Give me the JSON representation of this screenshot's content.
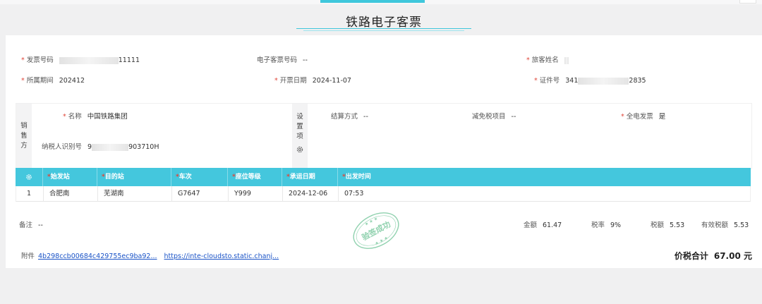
{
  "title": "铁路电子客票",
  "fields": {
    "invoice_no": {
      "label": "发票号码",
      "value": "11111"
    },
    "e_ticket_no": {
      "label": "电子客票号码",
      "value": "--"
    },
    "passenger": {
      "label": "旅客姓名",
      "value": ""
    },
    "period": {
      "label": "所属期间",
      "value": "202412"
    },
    "issue_date": {
      "label": "开票日期",
      "value": "2024-11-07"
    },
    "id_no": {
      "label": "证件号",
      "value_prefix": "341",
      "value_suffix": "2835"
    }
  },
  "seller": {
    "side_label": [
      "销",
      "售",
      "方"
    ],
    "name": {
      "label": "名称",
      "value": "中国铁路集团"
    },
    "tax_id": {
      "label": "纳税人识别号",
      "value_prefix": "9",
      "value_suffix": "903710H"
    }
  },
  "settings": {
    "side_label": [
      "设",
      "置",
      "项"
    ],
    "settlement": {
      "label": "结算方式",
      "value": "--"
    },
    "tax_exempt": {
      "label": "减免税项目",
      "value": "--"
    },
    "full_e_invoice": {
      "label": "全电发票",
      "value": "是"
    }
  },
  "table": {
    "columns": [
      "始发站",
      "目的站",
      "车次",
      "座位等级",
      "承运日期",
      "出发时间"
    ],
    "rows": [
      {
        "index": "1",
        "cells": [
          "合肥南",
          "芜湖南",
          "G7647",
          "Y999",
          "2024-12-06",
          "07:53"
        ]
      }
    ]
  },
  "remark": {
    "label": "备注",
    "value": "--"
  },
  "amounts": {
    "amount": {
      "label": "金额",
      "value": "61.47"
    },
    "tax_rate": {
      "label": "税率",
      "value": "9%"
    },
    "tax": {
      "label": "税额",
      "value": "5.53"
    },
    "effective_tax": {
      "label": "有效税额",
      "value": "5.53"
    }
  },
  "attachments": {
    "label": "附件",
    "file": "4b298ccb00684c429755ec9ba92...",
    "url": "https://inte-cloudsto.static.chanj..."
  },
  "stamp_text": "验签成功",
  "total": {
    "label": "价税合计",
    "value": "67.00 元"
  },
  "colors": {
    "accent": "#44c7dd",
    "required": "#e0463a",
    "link": "#1a53c7",
    "stamp": "#7cc9a0"
  }
}
